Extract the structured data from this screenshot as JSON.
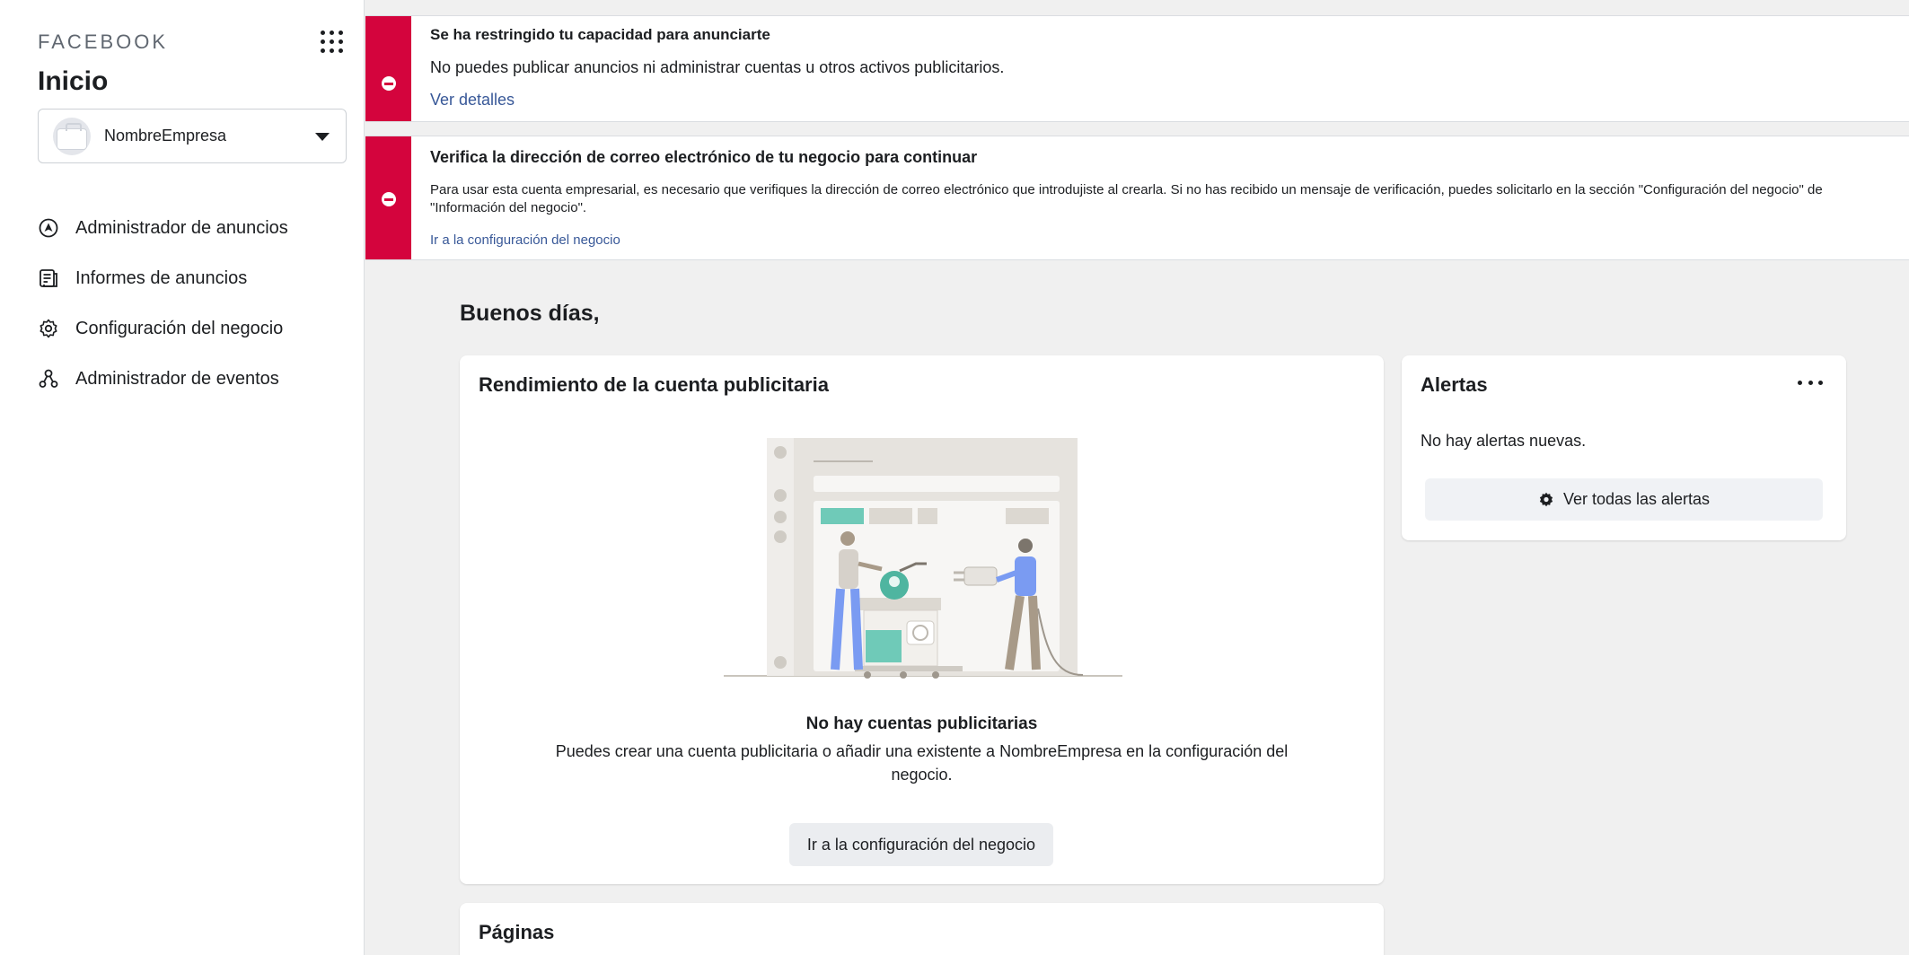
{
  "sidebar": {
    "brand": "FACEBOOK",
    "title": "Inicio",
    "business_name": "NombreEmpresa",
    "nav": [
      {
        "label": "Administrador de anuncios",
        "icon": "ads-manager-icon"
      },
      {
        "label": "Informes de anuncios",
        "icon": "ads-reports-icon"
      },
      {
        "label": "Configuración del negocio",
        "icon": "gear-icon"
      },
      {
        "label": "Administrador de eventos",
        "icon": "events-manager-icon"
      }
    ]
  },
  "banners": [
    {
      "title": "Se ha restringido tu capacidad para anunciarte",
      "text": "No puedes publicar anuncios ni administrar cuentas u otros activos publicitarios.",
      "link": "Ver detalles"
    },
    {
      "title": "Verifica la dirección de correo electrónico de tu negocio para continuar",
      "text": "Para usar esta cuenta empresarial, es necesario que verifiques la dirección de correo electrónico que introdujiste al crearla. Si no has recibido un mensaje de verificación, puedes solicitarlo en la sección \"Configuración del negocio\" de \"Información del negocio\".",
      "link": "Ir a la configuración del negocio"
    }
  ],
  "main": {
    "greeting": "Buenos días,",
    "performance": {
      "title": "Rendimiento de la cuenta publicitaria",
      "empty_title": "No hay cuentas publicitarias",
      "empty_desc": "Puedes crear una cuenta publicitaria o añadir una existente a NombreEmpresa en la configuración del negocio.",
      "button": "Ir a la configuración del negocio"
    },
    "alerts": {
      "title": "Alertas",
      "empty": "No hay alertas nuevas.",
      "button": "Ver todas las alertas"
    },
    "pages": {
      "title": "Páginas"
    }
  },
  "colors": {
    "banner_error": "#d4043d",
    "link": "#385898",
    "background": "#f0f0f0"
  }
}
